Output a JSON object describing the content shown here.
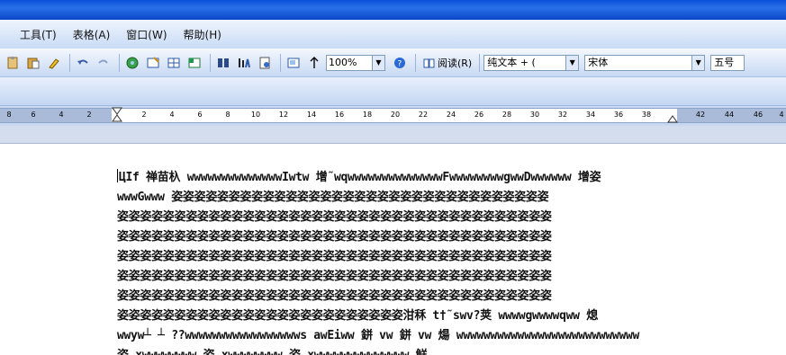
{
  "menubar": {
    "items": [
      "工具(T)",
      "表格(A)",
      "窗口(W)",
      "帮助(H)"
    ]
  },
  "toolbar": {
    "icons": [
      "paste-icon",
      "clipboard-icon",
      "format-painter-icon",
      "undo-icon",
      "redo-icon",
      "hyperlink-icon",
      "tables-borders-icon",
      "insert-table-icon",
      "insert-excel-icon",
      "columns-icon",
      "drawing-icon",
      "document-map-icon",
      "show-hide-icon",
      "word-count-icon"
    ],
    "zoom_value": "100%",
    "help_icon": "help-icon",
    "read_label": "阅读(R)",
    "style_value": "纯文本 + (",
    "font_value": "宋体",
    "size_value": "五号"
  },
  "ruler": {
    "numbers": [
      "8",
      "6",
      "4",
      "2",
      "2",
      "4",
      "6",
      "8",
      "10",
      "12",
      "14",
      "16",
      "18",
      "20",
      "22",
      "24",
      "26",
      "28",
      "30",
      "32",
      "34",
      "36",
      "38",
      "42",
      "44",
      "46",
      "4"
    ]
  },
  "document": {
    "lines": [
      "ЦIf 禅苗杁 wwwwwwwwwwwwwwIwtw 增˜wqwwwwwwwwwwwwwwFwwwwwwwwgwwDwwwwww 增姿",
      "wwwGwww 姿姿姿姿姿姿姿姿姿姿姿姿姿姿姿姿姿姿姿姿姿姿姿姿姿姿姿姿姿姿姿姿姿",
      "姿姿姿姿姿姿姿姿姿姿姿姿姿姿姿姿姿姿姿姿姿姿姿姿姿姿姿姿姿姿姿姿姿姿姿姿姿姿",
      "姿姿姿姿姿姿姿姿姿姿姿姿姿姿姿姿姿姿姿姿姿姿姿姿姿姿姿姿姿姿姿姿姿姿姿姿姿姿",
      "姿姿姿姿姿姿姿姿姿姿姿姿姿姿姿姿姿姿姿姿姿姿姿姿姿姿姿姿姿姿姿姿姿姿姿姿姿姿",
      "姿姿姿姿姿姿姿姿姿姿姿姿姿姿姿姿姿姿姿姿姿姿姿姿姿姿姿姿姿姿姿姿姿姿姿姿姿姿",
      "姿姿姿姿姿姿姿姿姿姿姿姿姿姿姿姿姿姿姿姿姿姿姿姿姿姿姿姿姿姿姿姿姿姿姿姿姿姿",
      "姿姿姿姿姿姿姿姿姿姿姿姿姿姿姿姿姿姿姿姿姿姿姿姿姿泔秝 t†˜swv?荚 wwwwgwwwwqww 熄",
      "wwyw┴ ┴ ??wwwwwwwwwwwwwwwwws awEiww 鉼 vw 鉼 vw 煬 wwwwwwwwwwwwwwwwwwwwwwwwwww",
      "姿        xwwwwwwww        姿        xwwwwwwww        姿        xwwwwwwwwwwwwww        觧"
    ]
  },
  "colors": {
    "titlebar": "#0a50d8",
    "toolbar_bg": "#c7d9f3",
    "ruler_margin": "#a9bbd8"
  }
}
